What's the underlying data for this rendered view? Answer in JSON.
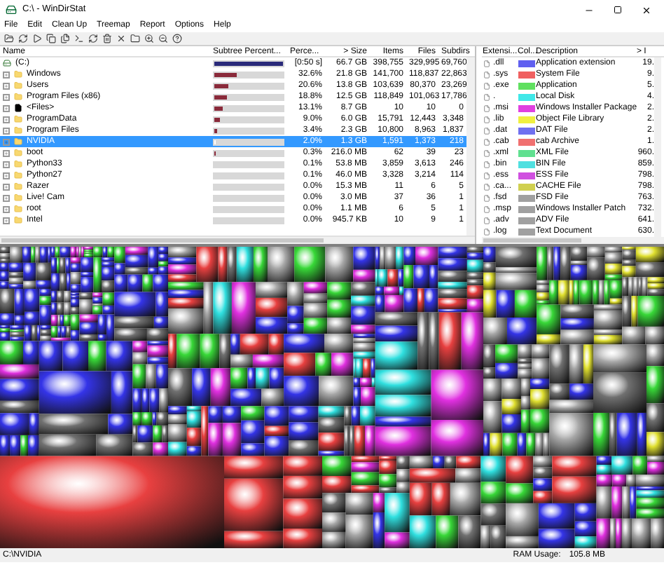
{
  "window": {
    "title": "C:\\ - WinDirStat"
  },
  "menu": [
    "File",
    "Edit",
    "Clean Up",
    "Treemap",
    "Report",
    "Options",
    "Help"
  ],
  "tree": {
    "columns": [
      "Name",
      "Subtree Percent...",
      "Perce...",
      "> Size",
      "Items",
      "Files",
      "Subdirs"
    ],
    "rows": [
      {
        "kind": "drive",
        "name": "(C:)",
        "level": 1,
        "percent": "[0:50 s]",
        "size": "66.7 GB",
        "items": "398,755",
        "files": "329,995",
        "subdirs": "69,760",
        "selected": false
      },
      {
        "kind": "folder",
        "name": "Windows",
        "level": 0.326,
        "percent": "32.6%",
        "size": "21.8 GB",
        "items": "141,700",
        "files": "118,837",
        "subdirs": "22,863",
        "selected": false
      },
      {
        "kind": "folder",
        "name": "Users",
        "level": 0.206,
        "percent": "20.6%",
        "size": "13.8 GB",
        "items": "103,639",
        "files": "80,370",
        "subdirs": "23,269",
        "selected": false
      },
      {
        "kind": "folder",
        "name": "Program Files (x86)",
        "level": 0.188,
        "percent": "18.8%",
        "size": "12.5 GB",
        "items": "118,849",
        "files": "101,063",
        "subdirs": "17,786",
        "selected": false
      },
      {
        "kind": "files",
        "name": "<Files>",
        "level": 0.131,
        "percent": "13.1%",
        "size": "8.7 GB",
        "items": "10",
        "files": "10",
        "subdirs": "0",
        "selected": false
      },
      {
        "kind": "folder",
        "name": "ProgramData",
        "level": 0.09,
        "percent": "9.0%",
        "size": "6.0 GB",
        "items": "15,791",
        "files": "12,443",
        "subdirs": "3,348",
        "selected": false
      },
      {
        "kind": "folder",
        "name": "Program Files",
        "level": 0.034,
        "percent": "3.4%",
        "size": "2.3 GB",
        "items": "10,800",
        "files": "8,963",
        "subdirs": "1,837",
        "selected": false
      },
      {
        "kind": "folder",
        "name": "NVIDIA",
        "level": 0.02,
        "percent": "2.0%",
        "size": "1.3 GB",
        "items": "1,591",
        "files": "1,373",
        "subdirs": "218",
        "selected": true
      },
      {
        "kind": "folder",
        "name": "boot",
        "level": 0.003,
        "percent": "0.3%",
        "size": "216.0 MB",
        "items": "62",
        "files": "39",
        "subdirs": "23",
        "selected": false
      },
      {
        "kind": "folder",
        "name": "Python33",
        "level": 0.001,
        "percent": "0.1%",
        "size": "53.8 MB",
        "items": "3,859",
        "files": "3,613",
        "subdirs": "246",
        "selected": false
      },
      {
        "kind": "folder",
        "name": "Python27",
        "level": 0.001,
        "percent": "0.1%",
        "size": "46.0 MB",
        "items": "3,328",
        "files": "3,214",
        "subdirs": "114",
        "selected": false
      },
      {
        "kind": "folder",
        "name": "Razer",
        "level": 0,
        "percent": "0.0%",
        "size": "15.3 MB",
        "items": "11",
        "files": "6",
        "subdirs": "5",
        "selected": false
      },
      {
        "kind": "folder",
        "name": "Live! Cam",
        "level": 0,
        "percent": "0.0%",
        "size": "3.0 MB",
        "items": "37",
        "files": "36",
        "subdirs": "1",
        "selected": false
      },
      {
        "kind": "folder",
        "name": "root",
        "level": 0,
        "percent": "0.0%",
        "size": "1.1 MB",
        "items": "6",
        "files": "5",
        "subdirs": "1",
        "selected": false
      },
      {
        "kind": "folder",
        "name": "Intel",
        "level": 0,
        "percent": "0.0%",
        "size": "945.7 KB",
        "items": "10",
        "files": "9",
        "subdirs": "1",
        "selected": false
      }
    ]
  },
  "extensions": {
    "columns": [
      "Extensi...",
      "Col...",
      "Description",
      "> I"
    ],
    "rows": [
      {
        "ext": ".dll",
        "color": "#6060f0",
        "description": "Application extension",
        "size": "19."
      },
      {
        "ext": ".sys",
        "color": "#f06060",
        "description": "System File",
        "size": "9."
      },
      {
        "ext": ".exe",
        "color": "#60e060",
        "description": "Application",
        "size": "5."
      },
      {
        "ext": ".",
        "color": "#40e8e8",
        "description": "Local Disk",
        "size": "4."
      },
      {
        "ext": ".msi",
        "color": "#e040e0",
        "description": "Windows Installer Package",
        "size": "2."
      },
      {
        "ext": ".lib",
        "color": "#f0f040",
        "description": "Object File Library",
        "size": "2."
      },
      {
        "ext": ".dat",
        "color": "#7070f0",
        "description": "DAT File",
        "size": "2."
      },
      {
        "ext": ".cab",
        "color": "#f07070",
        "description": "cab Archive",
        "size": "1."
      },
      {
        "ext": ".xml",
        "color": "#60e090",
        "description": "XML File",
        "size": "960."
      },
      {
        "ext": ".bin",
        "color": "#50e0e0",
        "description": "BIN File",
        "size": "859."
      },
      {
        "ext": ".ess",
        "color": "#d050e0",
        "description": "ESS File",
        "size": "798."
      },
      {
        "ext": ".ca...",
        "color": "#d0d050",
        "description": "CACHE File",
        "size": "798."
      },
      {
        "ext": ".fsd",
        "color": "#a0a0a0",
        "description": "FSD File",
        "size": "763."
      },
      {
        "ext": ".msp",
        "color": "#a0a0a0",
        "description": "Windows Installer Patch",
        "size": "732."
      },
      {
        "ext": ".adv",
        "color": "#a0a0a0",
        "description": "ADV File",
        "size": "641."
      },
      {
        "ext": ".log",
        "color": "#a0a0a0",
        "description": "Text Document",
        "size": "630."
      }
    ]
  },
  "status_bar": {
    "path": "C:\\NVIDIA",
    "ram_label": "RAM Usage:",
    "ram_value": "105.8 MB"
  }
}
